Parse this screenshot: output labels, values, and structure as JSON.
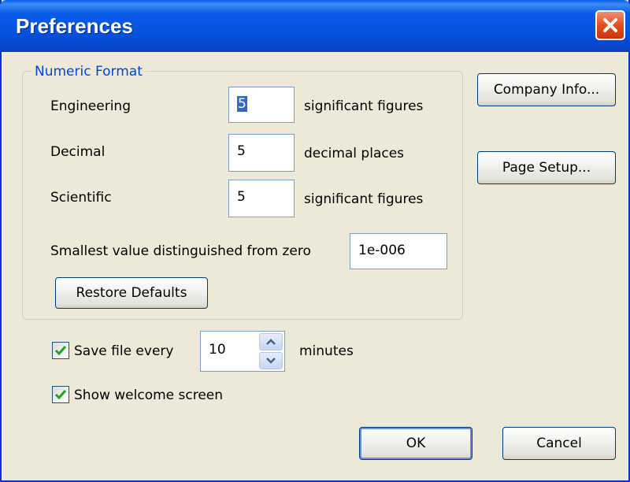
{
  "window": {
    "title": "Preferences"
  },
  "numeric_format": {
    "legend": "Numeric Format",
    "engineering": {
      "label": "Engineering",
      "value": "5",
      "unit": "significant figures"
    },
    "decimal": {
      "label": "Decimal",
      "value": "5",
      "unit": "decimal places"
    },
    "scientific": {
      "label": "Scientific",
      "value": "5",
      "unit": "significant figures"
    },
    "smallest": {
      "label": "Smallest value distinguished from zero",
      "value": "1e-006"
    },
    "restore_label": "Restore Defaults"
  },
  "side_buttons": {
    "company_info": "Company Info...",
    "page_setup": "Page Setup..."
  },
  "autosave": {
    "checked": true,
    "label": "Save file every",
    "value": "10",
    "unit": "minutes"
  },
  "welcome": {
    "checked": true,
    "label": "Show welcome screen"
  },
  "footer": {
    "ok": "OK",
    "cancel": "Cancel"
  },
  "colors": {
    "accent": "#0a5de8",
    "legend": "#0046d5",
    "window_bg": "#ece9d8",
    "check": "#21a121",
    "close": "#e3501f"
  },
  "icons": {
    "close": "close-icon",
    "check": "checkmark-icon",
    "spin_up": "chevron-up-icon",
    "spin_down": "chevron-down-icon"
  }
}
